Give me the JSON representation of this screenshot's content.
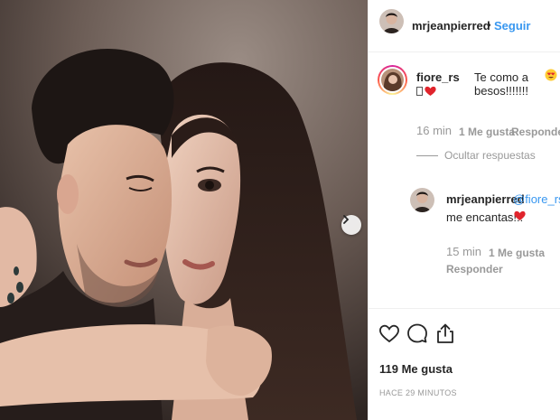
{
  "header": {
    "username": "mrjeanpierred",
    "dot": "•",
    "follow_label": "Seguir"
  },
  "comments": [
    {
      "username": "fiore_rs",
      "text": "Te como a besos!!!!!!!",
      "time": "16 min",
      "likes": "1 Me gusta",
      "reply_label": "Responder",
      "hide_replies_label": "Ocultar respuestas"
    }
  ],
  "reply": {
    "username": "mrjeanpierred",
    "mention": "@fiore_rs",
    "text": "me encantas!!!",
    "time": "15 min",
    "likes": "1 Me gusta",
    "reply_label": "Responder"
  },
  "actions": {
    "icons": [
      "heart-icon",
      "comment-icon",
      "share-icon"
    ]
  },
  "post": {
    "likes": "119 Me gusta",
    "time_ago": "HACE 29 MINUTOS"
  },
  "colors": {
    "link": "#3897f0",
    "heart": "#e0242c",
    "muted": "#999999"
  }
}
